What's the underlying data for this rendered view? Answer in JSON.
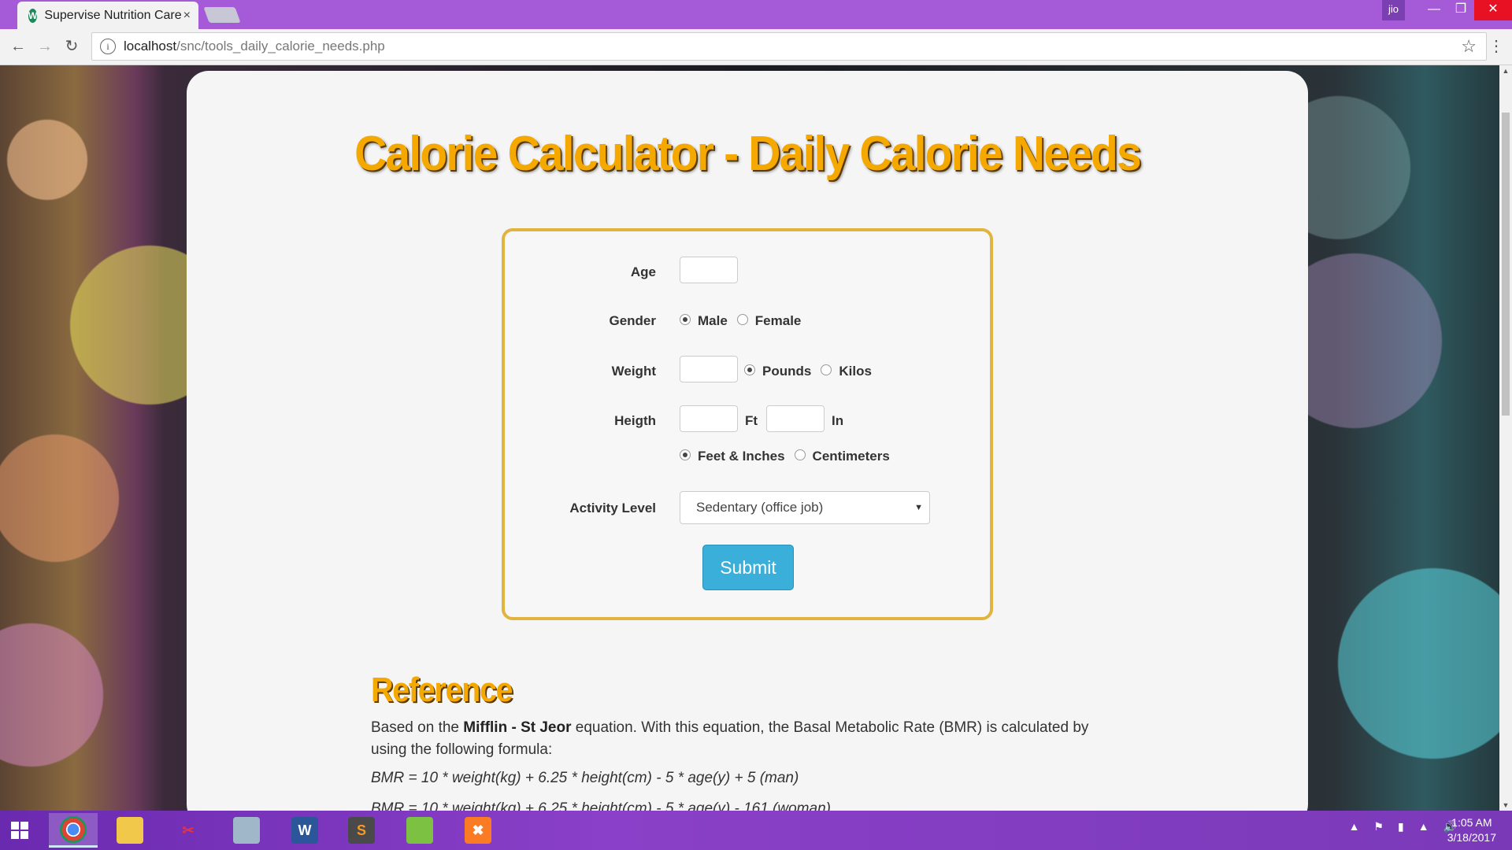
{
  "browser": {
    "tab_title": "Supervise Nutrition Care",
    "tab_close": "×",
    "profile_name": "jio",
    "url_host": "localhost",
    "url_path": "/snc/tools_daily_calorie_needs.php"
  },
  "page": {
    "title": "Calorie Calculator - Daily Calorie Needs",
    "form": {
      "age_label": "Age",
      "gender_label": "Gender",
      "gender_options": [
        "Male",
        "Female"
      ],
      "gender_selected": "Male",
      "weight_label": "Weight",
      "weight_units": [
        "Pounds",
        "Kilos"
      ],
      "weight_unit_selected": "Pounds",
      "height_label": "Heigth",
      "height_ft_unit": "Ft",
      "height_in_unit": "In",
      "height_modes": [
        "Feet & Inches",
        "Centimeters"
      ],
      "height_mode_selected": "Feet & Inches",
      "activity_label": "Activity Level",
      "activity_value": "Sedentary (office job)",
      "submit_label": "Submit"
    },
    "reference": {
      "title": "Reference",
      "intro_pre": "Based on the ",
      "intro_bold": "Mifflin - St Jeor",
      "intro_post": " equation. With this equation, the Basal Metabolic Rate (BMR) is calculated by using the following formula:",
      "formula_man": "BMR = 10 * weight(kg) + 6.25 * height(cm) - 5 * age(y) + 5 (man)",
      "formula_woman": "BMR = 10 * weight(kg) + 6.25 * height(cm) - 5 * age(y) - 161 (woman)"
    }
  },
  "taskbar": {
    "time": "1:05 AM",
    "date": "3/18/2017"
  }
}
